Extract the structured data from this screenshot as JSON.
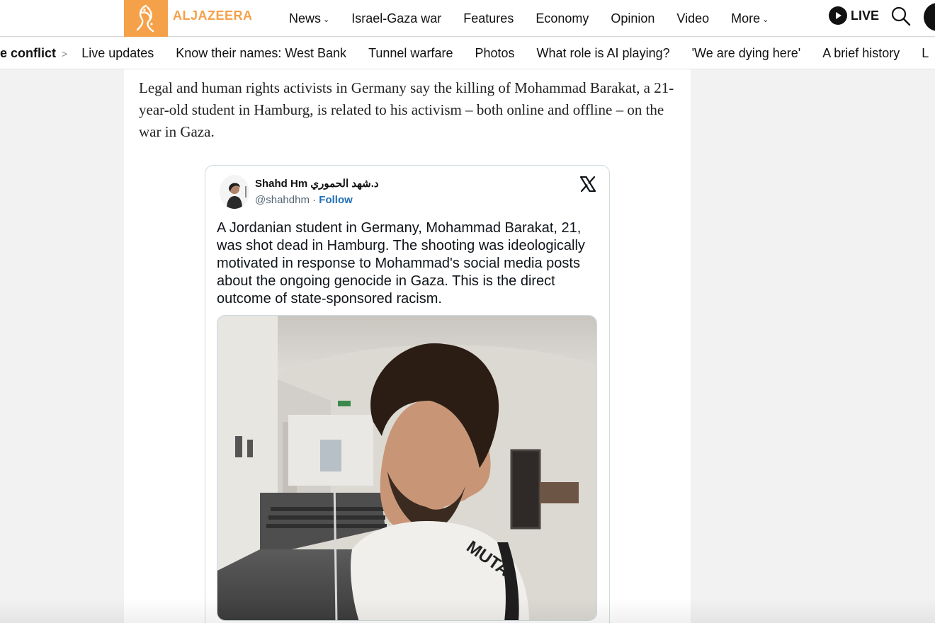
{
  "header": {
    "logo_text": "ALJAZEERA",
    "brand_color": "#f5a14a",
    "nav": [
      {
        "label": "News",
        "has_dropdown": true
      },
      {
        "label": "Israel-Gaza war",
        "has_dropdown": false
      },
      {
        "label": "Features",
        "has_dropdown": false
      },
      {
        "label": "Economy",
        "has_dropdown": false
      },
      {
        "label": "Opinion",
        "has_dropdown": false
      },
      {
        "label": "Video",
        "has_dropdown": false
      },
      {
        "label": "More",
        "has_dropdown": true
      }
    ],
    "live_label": "LIVE",
    "icons": {
      "live": "play-icon",
      "search": "search-icon"
    }
  },
  "subnav": {
    "title": "e conflict",
    "separator": ">",
    "links": [
      "Live updates",
      "Know their names: West Bank",
      "Tunnel warfare",
      "Photos",
      "What role is AI playing?",
      "'We are dying here'",
      "A brief history",
      "L"
    ]
  },
  "article": {
    "paragraph": "Legal and human rights activists in Germany say the killing of Mohammad Barakat, a 21-year-old student in Hamburg, is related to his activism – both online and offline – on the war in Gaza."
  },
  "tweet": {
    "author": "Shahd Hm د.شهد الحموري",
    "handle": "@shahdhm",
    "dot": "·",
    "follow_label": "Follow",
    "text": "A Jordanian student in Germany, Mohammad Barakat, 21, was shot dead in Hamburg. The shooting was ideologically motivated in response to Mohammad's social media posts about the ongoing genocide in Gaza. This is the direct outcome of state-sponsored racism.",
    "media_caption": "MUTA",
    "icons": {
      "platform": "x-logo-icon"
    }
  }
}
